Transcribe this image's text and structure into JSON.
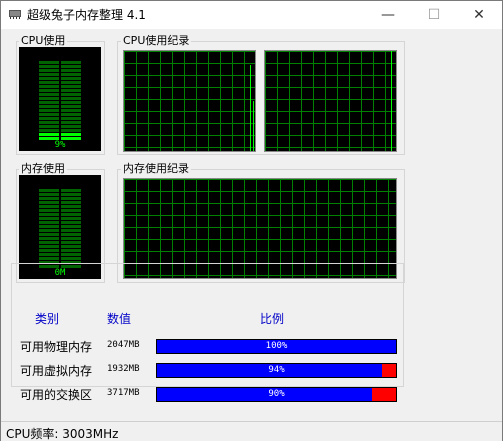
{
  "window": {
    "title": "超级兔子内存整理 4.1",
    "min_glyph": "—",
    "max_glyph": "☐",
    "close_glyph": "✕"
  },
  "cpu_usage": {
    "label": "CPU使用",
    "value_text": "9%",
    "level": 0.09
  },
  "cpu_history": {
    "label": "CPU使用纪录"
  },
  "mem_usage": {
    "label": "内存使用",
    "value_text": "0M",
    "level": 0.0
  },
  "mem_history": {
    "label": "内存使用纪录"
  },
  "table": {
    "headers": {
      "category": "类别",
      "value": "数值",
      "ratio": "比例"
    },
    "rows": [
      {
        "label": "可用物理内存",
        "value": "2047MB",
        "percent_text": "100%",
        "percent": 100
      },
      {
        "label": "可用虚拟内存",
        "value": "1932MB",
        "percent_text": "94%",
        "percent": 94
      },
      {
        "label": "可用的交换区",
        "value": "3717MB",
        "percent_text": "90%",
        "percent": 90
      }
    ]
  },
  "status": {
    "text": "CPU频率: 3003MHz"
  },
  "colors": {
    "grid_line": "#008000",
    "trace": "#00ff00",
    "bar_used": "#0000ff",
    "bar_free": "#ff0000",
    "header_text": "#0000c8"
  }
}
